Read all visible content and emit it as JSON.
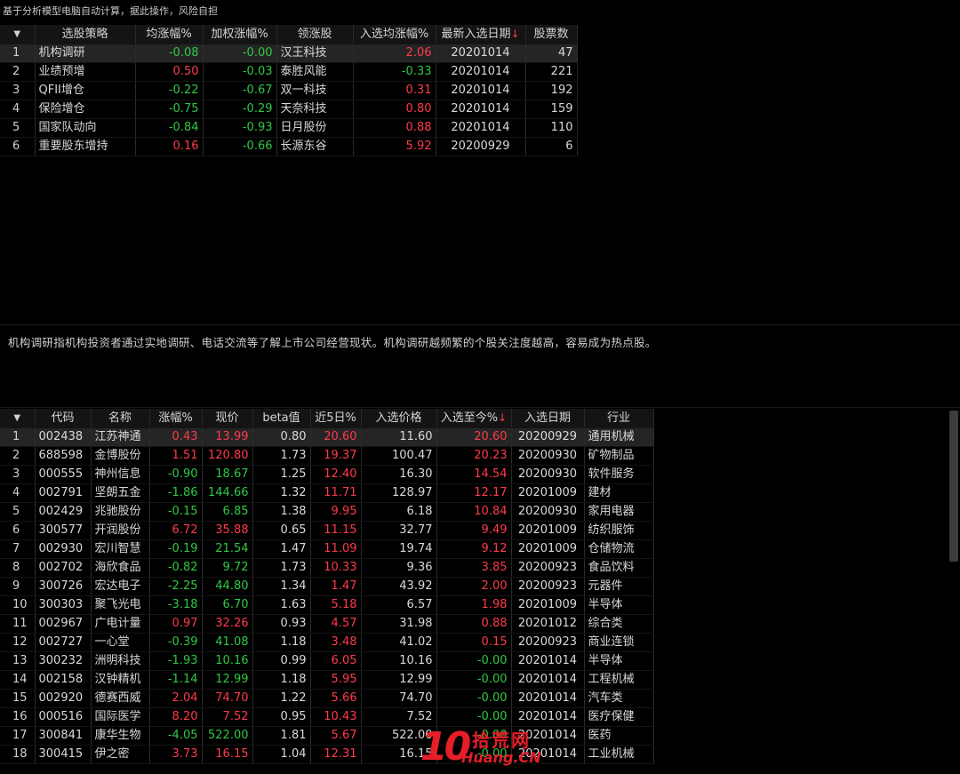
{
  "notice": "基于分析模型电脑自动计算，据此操作，风险自担",
  "strategy_table": {
    "headers": [
      "选股策略",
      "均涨幅%",
      "加权涨幅%",
      "领涨股",
      "入选均涨幅%",
      "最新入选日期",
      "股票数"
    ],
    "sort_arrow": "↓",
    "rows": [
      {
        "idx": "1",
        "name": "机构调研",
        "avg": "-0.08",
        "weighted": "-0.00",
        "leader": "汉王科技",
        "sel_avg": "2.06",
        "date": "20201014",
        "count": "47"
      },
      {
        "idx": "2",
        "name": "业绩预增",
        "avg": "0.50",
        "weighted": "-0.03",
        "leader": "泰胜风能",
        "sel_avg": "-0.33",
        "date": "20201014",
        "count": "221"
      },
      {
        "idx": "3",
        "name": "QFII增仓",
        "avg": "-0.22",
        "weighted": "-0.67",
        "leader": "双一科技",
        "sel_avg": "0.31",
        "date": "20201014",
        "count": "192"
      },
      {
        "idx": "4",
        "name": "保险增仓",
        "avg": "-0.75",
        "weighted": "-0.29",
        "leader": "天奈科技",
        "sel_avg": "0.80",
        "date": "20201014",
        "count": "159"
      },
      {
        "idx": "5",
        "name": "国家队动向",
        "avg": "-0.84",
        "weighted": "-0.93",
        "leader": "日月股份",
        "sel_avg": "0.88",
        "date": "20201014",
        "count": "110"
      },
      {
        "idx": "6",
        "name": "重要股东增持",
        "avg": "0.16",
        "weighted": "-0.66",
        "leader": "长源东谷",
        "sel_avg": "5.92",
        "date": "20200929",
        "count": "6"
      }
    ]
  },
  "description": "机构调研指机构投资者通过实地调研、电话交流等了解上市公司经营现状。机构调研越频繁的个股关注度越高，容易成为热点股。",
  "stock_table": {
    "headers": [
      "代码",
      "名称",
      "涨幅%",
      "现价",
      "beta值",
      "近5日%",
      "入选价格",
      "入选至今%",
      "入选日期",
      "行业"
    ],
    "sort_arrow": "↓",
    "rows": [
      {
        "idx": "1",
        "code": "002438",
        "name": "江苏神通",
        "chg": "0.43",
        "price": "13.99",
        "beta": "0.80",
        "d5": "20.60",
        "sel_price": "11.60",
        "since": "20.60",
        "date": "20200929",
        "industry": "通用机械"
      },
      {
        "idx": "2",
        "code": "688598",
        "name": "金博股份",
        "chg": "1.51",
        "price": "120.80",
        "beta": "1.73",
        "d5": "19.37",
        "sel_price": "100.47",
        "since": "20.23",
        "date": "20200930",
        "industry": "矿物制品"
      },
      {
        "idx": "3",
        "code": "000555",
        "name": "神州信息",
        "chg": "-0.90",
        "price": "18.67",
        "beta": "1.25",
        "d5": "12.40",
        "sel_price": "16.30",
        "since": "14.54",
        "date": "20200930",
        "industry": "软件服务"
      },
      {
        "idx": "4",
        "code": "002791",
        "name": "坚朗五金",
        "chg": "-1.86",
        "price": "144.66",
        "beta": "1.32",
        "d5": "11.71",
        "sel_price": "128.97",
        "since": "12.17",
        "date": "20201009",
        "industry": "建材"
      },
      {
        "idx": "5",
        "code": "002429",
        "name": "兆驰股份",
        "chg": "-0.15",
        "price": "6.85",
        "beta": "1.38",
        "d5": "9.95",
        "sel_price": "6.18",
        "since": "10.84",
        "date": "20200930",
        "industry": "家用电器"
      },
      {
        "idx": "6",
        "code": "300577",
        "name": "开润股份",
        "chg": "6.72",
        "price": "35.88",
        "beta": "0.65",
        "d5": "11.15",
        "sel_price": "32.77",
        "since": "9.49",
        "date": "20201009",
        "industry": "纺织服饰"
      },
      {
        "idx": "7",
        "code": "002930",
        "name": "宏川智慧",
        "chg": "-0.19",
        "price": "21.54",
        "beta": "1.47",
        "d5": "11.09",
        "sel_price": "19.74",
        "since": "9.12",
        "date": "20201009",
        "industry": "仓储物流"
      },
      {
        "idx": "8",
        "code": "002702",
        "name": "海欣食品",
        "chg": "-0.82",
        "price": "9.72",
        "beta": "1.73",
        "d5": "10.33",
        "sel_price": "9.36",
        "since": "3.85",
        "date": "20200923",
        "industry": "食品饮料"
      },
      {
        "idx": "9",
        "code": "300726",
        "name": "宏达电子",
        "chg": "-2.25",
        "price": "44.80",
        "beta": "1.34",
        "d5": "1.47",
        "sel_price": "43.92",
        "since": "2.00",
        "date": "20200923",
        "industry": "元器件"
      },
      {
        "idx": "10",
        "code": "300303",
        "name": "聚飞光电",
        "chg": "-3.18",
        "price": "6.70",
        "beta": "1.63",
        "d5": "5.18",
        "sel_price": "6.57",
        "since": "1.98",
        "date": "20201009",
        "industry": "半导体"
      },
      {
        "idx": "11",
        "code": "002967",
        "name": "广电计量",
        "chg": "0.97",
        "price": "32.26",
        "beta": "0.93",
        "d5": "4.57",
        "sel_price": "31.98",
        "since": "0.88",
        "date": "20201012",
        "industry": "综合类"
      },
      {
        "idx": "12",
        "code": "002727",
        "name": "一心堂",
        "chg": "-0.39",
        "price": "41.08",
        "beta": "1.18",
        "d5": "3.48",
        "sel_price": "41.02",
        "since": "0.15",
        "date": "20200923",
        "industry": "商业连锁"
      },
      {
        "idx": "13",
        "code": "300232",
        "name": "洲明科技",
        "chg": "-1.93",
        "price": "10.16",
        "beta": "0.99",
        "d5": "6.05",
        "sel_price": "10.16",
        "since": "-0.00",
        "date": "20201014",
        "industry": "半导体"
      },
      {
        "idx": "14",
        "code": "002158",
        "name": "汉钟精机",
        "chg": "-1.14",
        "price": "12.99",
        "beta": "1.18",
        "d5": "5.95",
        "sel_price": "12.99",
        "since": "-0.00",
        "date": "20201014",
        "industry": "工程机械"
      },
      {
        "idx": "15",
        "code": "002920",
        "name": "德赛西威",
        "chg": "2.04",
        "price": "74.70",
        "beta": "1.22",
        "d5": "5.66",
        "sel_price": "74.70",
        "since": "-0.00",
        "date": "20201014",
        "industry": "汽车类"
      },
      {
        "idx": "16",
        "code": "000516",
        "name": "国际医学",
        "chg": "8.20",
        "price": "7.52",
        "beta": "0.95",
        "d5": "10.43",
        "sel_price": "7.52",
        "since": "-0.00",
        "date": "20201014",
        "industry": "医疗保健"
      },
      {
        "idx": "17",
        "code": "300841",
        "name": "康华生物",
        "chg": "-4.05",
        "price": "522.00",
        "beta": "1.81",
        "d5": "5.67",
        "sel_price": "522.00",
        "since": "-0.00",
        "date": "20201014",
        "industry": "医药"
      },
      {
        "idx": "18",
        "code": "300415",
        "name": "伊之密",
        "chg": "3.73",
        "price": "16.15",
        "beta": "1.04",
        "d5": "12.31",
        "sel_price": "16.15",
        "since": "-0.00",
        "date": "20201014",
        "industry": "工业机械"
      }
    ]
  },
  "watermark": {
    "cn": "拾荒网",
    "en": "Huang.CN",
    "num": "10"
  },
  "colors": {
    "up": "#ff3a4a",
    "down": "#2fc845",
    "background": "#000000"
  }
}
